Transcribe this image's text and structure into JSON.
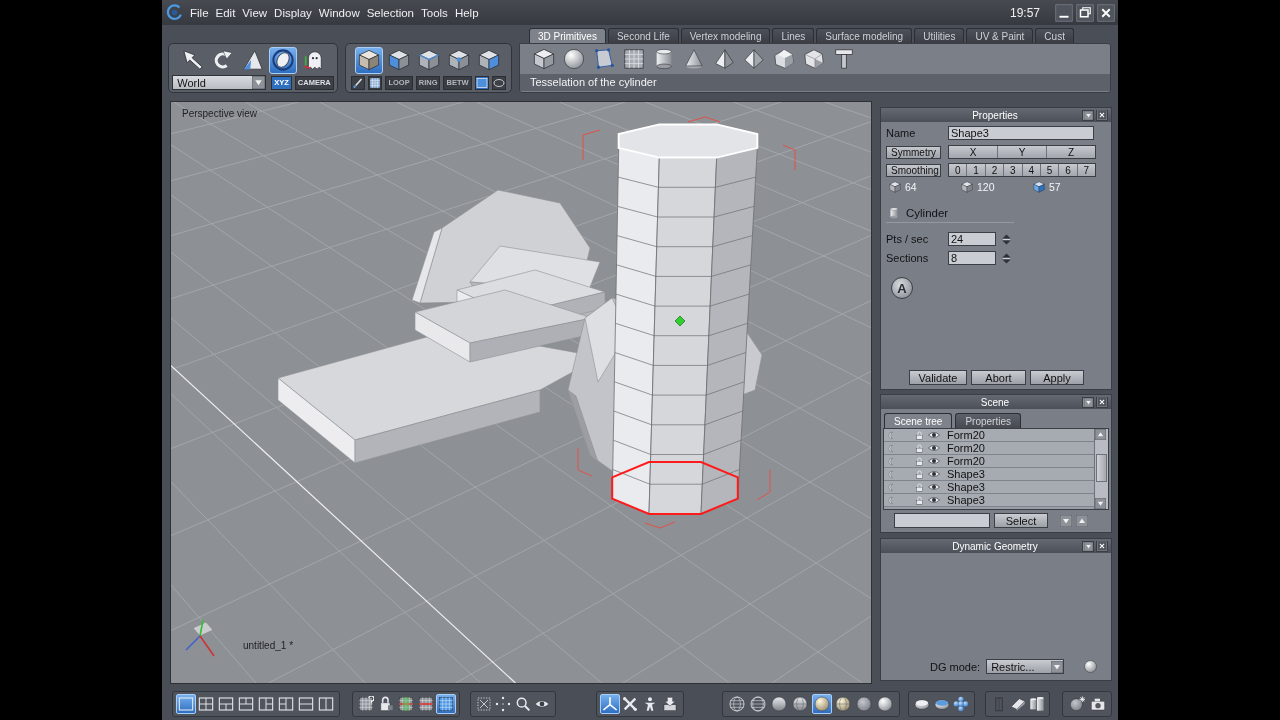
{
  "title_bar": {
    "menus": [
      {
        "label": "File"
      },
      {
        "label": "Edit"
      },
      {
        "label": "View"
      },
      {
        "label": "Display"
      },
      {
        "label": "Window"
      },
      {
        "label": "Selection"
      },
      {
        "label": "Tools"
      },
      {
        "label": "Help"
      }
    ],
    "clock": "19:57"
  },
  "toolbar": {
    "transform_tools": [
      {
        "kind": "arrow",
        "selected": false
      },
      {
        "kind": "rotate",
        "selected": false
      },
      {
        "kind": "scale",
        "selected": false
      },
      {
        "kind": "orbit",
        "selected": true
      },
      {
        "kind": "ghost",
        "selected": false
      }
    ],
    "reference": {
      "value": "World"
    },
    "axis_modes": [
      {
        "label": "XYZ",
        "selected": true
      },
      {
        "label": "CAMERA",
        "selected": false
      }
    ],
    "selection_modes": [
      {
        "kind": "sel-object",
        "selected": true
      },
      {
        "kind": "sel-face",
        "selected": false
      },
      {
        "kind": "sel-edge",
        "selected": false
      },
      {
        "kind": "sel-vertex",
        "selected": false
      },
      {
        "kind": "sel-auto",
        "selected": false
      }
    ],
    "selection_helpers": [
      {
        "kind": "brush"
      },
      {
        "kind": "mesh"
      }
    ],
    "edge_tools": [
      {
        "label": "LOOP",
        "disabled": true
      },
      {
        "label": "RING",
        "disabled": true
      },
      {
        "label": "BETW",
        "disabled": true
      }
    ],
    "selection_shapes": [
      {
        "kind": "rect-select",
        "selected": true
      },
      {
        "kind": "lasso",
        "selected": false
      }
    ]
  },
  "ribbon": {
    "tabs": [
      {
        "label": "3D Primitives",
        "selected": true
      },
      {
        "label": "Second Life",
        "selected": false
      },
      {
        "label": "Vertex modeling",
        "selected": false
      },
      {
        "label": "Lines",
        "selected": false
      },
      {
        "label": "Surface modeling",
        "selected": false
      },
      {
        "label": "Utilities",
        "selected": false
      },
      {
        "label": "UV & Paint",
        "selected": false
      },
      {
        "label": "Cust",
        "selected": false
      }
    ],
    "tools": [
      {
        "kind": "p-cube"
      },
      {
        "kind": "p-sphere"
      },
      {
        "kind": "p-plane"
      },
      {
        "kind": "p-grid"
      },
      {
        "kind": "p-cylinder"
      },
      {
        "kind": "p-cone"
      },
      {
        "kind": "p-pyramid"
      },
      {
        "kind": "p-octa"
      },
      {
        "kind": "p-dodeca"
      },
      {
        "kind": "p-icosa"
      },
      {
        "kind": "p-text"
      }
    ],
    "hint": "Tesselation of the cylinder"
  },
  "viewport": {
    "label": "Perspective view",
    "document": "untitled_1 *"
  },
  "properties": {
    "title": "Properties",
    "name": {
      "label": "Name",
      "value": "Shape3"
    },
    "symmetry": {
      "label": "Symmetry",
      "axes": [
        {
          "label": "X",
          "selected": false
        },
        {
          "label": "Y",
          "selected": false
        },
        {
          "label": "Z",
          "selected": false
        }
      ]
    },
    "smoothing": {
      "label": "Smoothing",
      "levels": [
        {
          "label": "0",
          "selected": false
        },
        {
          "label": "1",
          "selected": false
        },
        {
          "label": "2",
          "selected": false
        },
        {
          "label": "3",
          "selected": false
        },
        {
          "label": "4",
          "selected": false
        },
        {
          "label": "5",
          "selected": false
        },
        {
          "label": "6",
          "selected": false
        },
        {
          "label": "7",
          "selected": false
        }
      ]
    },
    "stats": [
      {
        "kind": "plain",
        "value": "64"
      },
      {
        "kind": "plain",
        "value": "120"
      },
      {
        "kind": "accent",
        "value": "57"
      }
    ],
    "object": "Cylinder",
    "parameters": [
      {
        "label": "Pts / sec",
        "value": "24"
      },
      {
        "label": "Sections",
        "value": "8"
      }
    ],
    "auto_label": "A",
    "actions": [
      {
        "label": "Validate"
      },
      {
        "label": "Abort"
      },
      {
        "label": "Apply"
      }
    ]
  },
  "scene": {
    "title": "Scene",
    "tabs": [
      {
        "label": "Scene tree",
        "selected": true
      },
      {
        "label": "Properties",
        "selected": false
      }
    ],
    "items": [
      {
        "name": "Form20"
      },
      {
        "name": "Form20"
      },
      {
        "name": "Form20"
      },
      {
        "name": "Shape3"
      },
      {
        "name": "Shape3"
      },
      {
        "name": "Shape3"
      }
    ],
    "select_label": "Select"
  },
  "dynamic_geometry": {
    "title": "Dynamic Geometry",
    "mode_label": "DG mode:",
    "mode_value": "Restric..."
  },
  "bottom_toolbar": {
    "groups": [
      {
        "tools": [
          {
            "kind": "lay-single",
            "selected": true
          },
          {
            "kind": "lay-quad",
            "selected": false
          },
          {
            "kind": "lay-top",
            "selected": false
          },
          {
            "kind": "lay-bottom",
            "selected": false
          },
          {
            "kind": "lay-left",
            "selected": false
          },
          {
            "kind": "lay-right",
            "selected": false
          },
          {
            "kind": "lay-rows",
            "selected": false
          },
          {
            "kind": "lay-cols",
            "selected": false
          }
        ]
      },
      {
        "tools": [
          {
            "kind": "grid-help",
            "selected": false
          },
          {
            "kind": "lock-blob",
            "selected": false
          },
          {
            "kind": "grid-red",
            "selected": false
          },
          {
            "kind": "grid-red2",
            "selected": false
          },
          {
            "kind": "grid-blue",
            "selected": true
          }
        ]
      },
      {
        "tools": [
          {
            "kind": "fit"
          },
          {
            "kind": "pan"
          },
          {
            "kind": "zoom"
          },
          {
            "kind": "eye"
          }
        ]
      },
      {
        "tools": [
          {
            "kind": "axis",
            "selected": true
          },
          {
            "kind": "xtool",
            "selected": false
          },
          {
            "kind": "figure",
            "selected": false
          },
          {
            "kind": "arrowbox",
            "selected": false
          }
        ]
      },
      {
        "tools": [
          {
            "kind": "wire-a",
            "selected": false
          },
          {
            "kind": "wire-b",
            "selected": false
          },
          {
            "kind": "flat",
            "selected": false
          },
          {
            "kind": "flat-grid",
            "selected": false
          },
          {
            "kind": "smooth",
            "selected": true
          },
          {
            "kind": "smooth-grid",
            "selected": false
          },
          {
            "kind": "matte",
            "selected": false
          },
          {
            "kind": "glossy",
            "selected": false
          }
        ]
      },
      {
        "tools": [
          {
            "kind": "disc"
          },
          {
            "kind": "disc-blue"
          },
          {
            "kind": "blobs"
          }
        ]
      },
      {
        "tools": [
          {
            "kind": "pillar"
          },
          {
            "kind": "bevel"
          },
          {
            "kind": "cups"
          }
        ]
      },
      {
        "tools": [
          {
            "kind": "lit-sphere"
          },
          {
            "kind": "camera"
          }
        ]
      }
    ]
  }
}
